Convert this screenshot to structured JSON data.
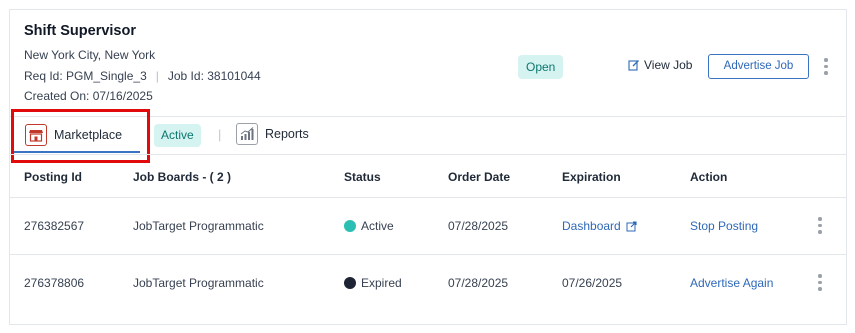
{
  "job": {
    "title": "Shift Supervisor",
    "location": "New York City, New York",
    "req_id": "Req Id: PGM_Single_3",
    "job_id": "Job Id: 38101044",
    "created": "Created On: 07/16/2025",
    "status": "Open",
    "view_job_label": "View Job",
    "advertise_label": "Advertise Job"
  },
  "tabs": {
    "marketplace": "Marketplace",
    "active_pill": "Active",
    "separator": "|",
    "reports": "Reports"
  },
  "table": {
    "headers": [
      "Posting Id",
      "Job Boards - ( 2 )",
      "Status",
      "Order Date",
      "Expiration",
      "Action"
    ],
    "rows": [
      {
        "posting_id": "276382567",
        "job_board": "JobTarget Programmatic",
        "status": "Active",
        "status_color": "#2bbfb3",
        "order_date": "07/28/2025",
        "expiration": "Dashboard",
        "action": "Stop Posting"
      },
      {
        "posting_id": "276378806",
        "job_board": "JobTarget Programmatic",
        "status": "Expired",
        "status_color": "#1e2433",
        "order_date": "07/28/2025",
        "expiration": "07/26/2025",
        "action": "Advertise Again"
      }
    ]
  },
  "colors": {
    "accent": "#3b73c4",
    "open_pill_bg": "#d4f3f1",
    "highlight": "#e10b0b"
  }
}
